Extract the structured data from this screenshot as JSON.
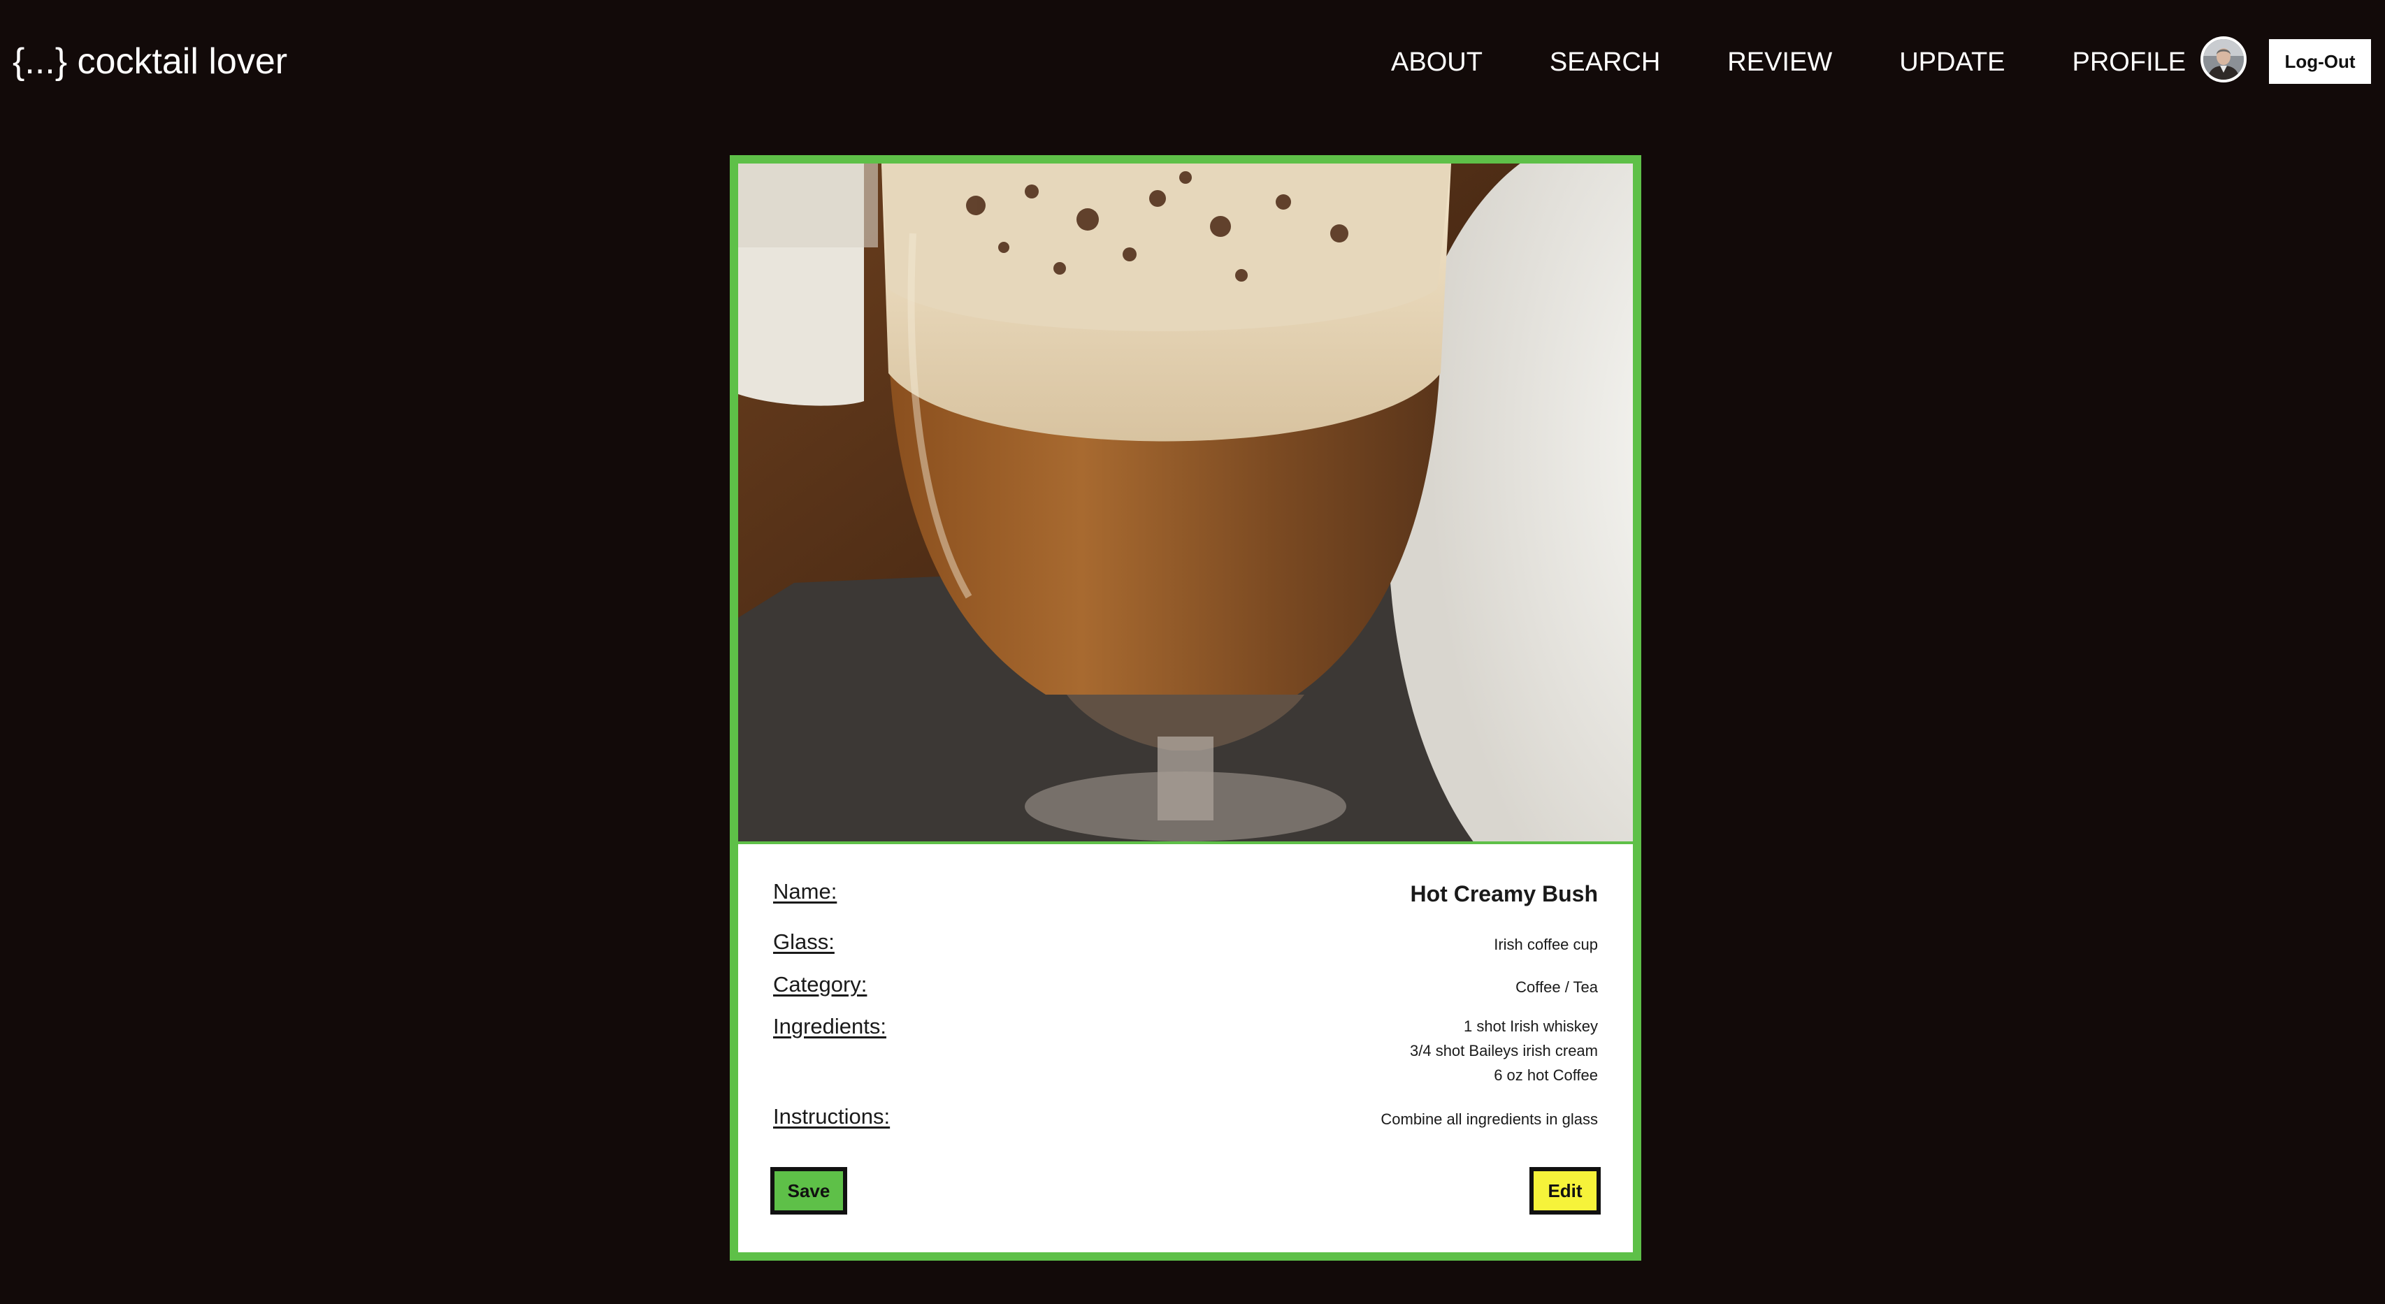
{
  "header": {
    "brand": "{...} cocktail lover",
    "nav": [
      "ABOUT",
      "SEARCH",
      "REVIEW",
      "UPDATE",
      "PROFILE"
    ],
    "logout_label": "Log-Out"
  },
  "card": {
    "image_icon": "cocktail-photo",
    "fields": {
      "name_label": "Name:",
      "name_value": "Hot Creamy Bush",
      "glass_label": "Glass:",
      "glass_value": "Irish coffee cup",
      "category_label": "Category:",
      "category_value": "Coffee / Tea",
      "ingredients_label": "Ingredients:",
      "ingredients": [
        "1 shot Irish whiskey",
        "3/4 shot Baileys irish cream",
        "6 oz hot Coffee"
      ],
      "instructions_label": "Instructions:",
      "instructions_value": "Combine all ingredients in glass"
    },
    "save_label": "Save",
    "edit_label": "Edit"
  },
  "colors": {
    "background": "#120a09",
    "accent_green": "#5ec048",
    "edit_yellow": "#f6f33a"
  }
}
